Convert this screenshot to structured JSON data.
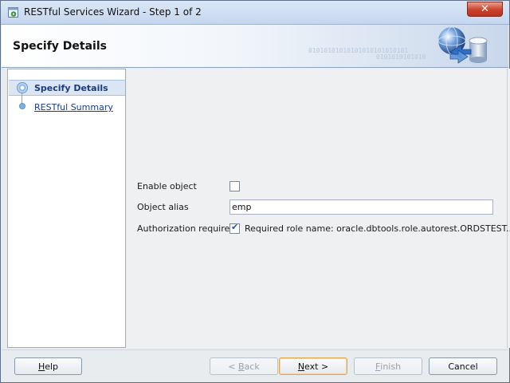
{
  "window": {
    "title": "RESTful Services Wizard - Step 1 of 2",
    "close_icon": "✕"
  },
  "header": {
    "title": "Specify Details",
    "binary_line1": "01010101010101010101010101",
    "binary_line2": "0101010101010"
  },
  "nav": {
    "steps": [
      {
        "label": "Specify Details",
        "selected": true
      },
      {
        "label": "RESTful Summary",
        "selected": false
      }
    ]
  },
  "form": {
    "enable_object_label": "Enable object",
    "enable_object_checked": false,
    "object_alias_label": "Object alias",
    "object_alias_value": "emp",
    "authorization_label": "Authorization required",
    "authorization_checked": true,
    "required_role_text": "Required role name: oracle.dbtools.role.autorest.ORDSTEST...."
  },
  "buttons": {
    "help_mnemonic": "H",
    "help_rest": "elp",
    "back_prefix": "< ",
    "back_mnemonic": "B",
    "back_rest": "ack",
    "next_mnemonic": "N",
    "next_rest": "ext >",
    "finish_mnemonic": "F",
    "finish_rest": "inish",
    "cancel_label": "Cancel"
  },
  "icons": {
    "app": "wizard-app-icon",
    "header_art": "database-globe-icon",
    "checkmark": "checkmark-icon"
  },
  "colors": {
    "title_bar": "#c4d6ee",
    "close_button": "#c9412a",
    "nav_selected_bg": "#dbe6f4",
    "nav_link": "#1a3b8e",
    "default_button_border": "#e0a94f"
  }
}
